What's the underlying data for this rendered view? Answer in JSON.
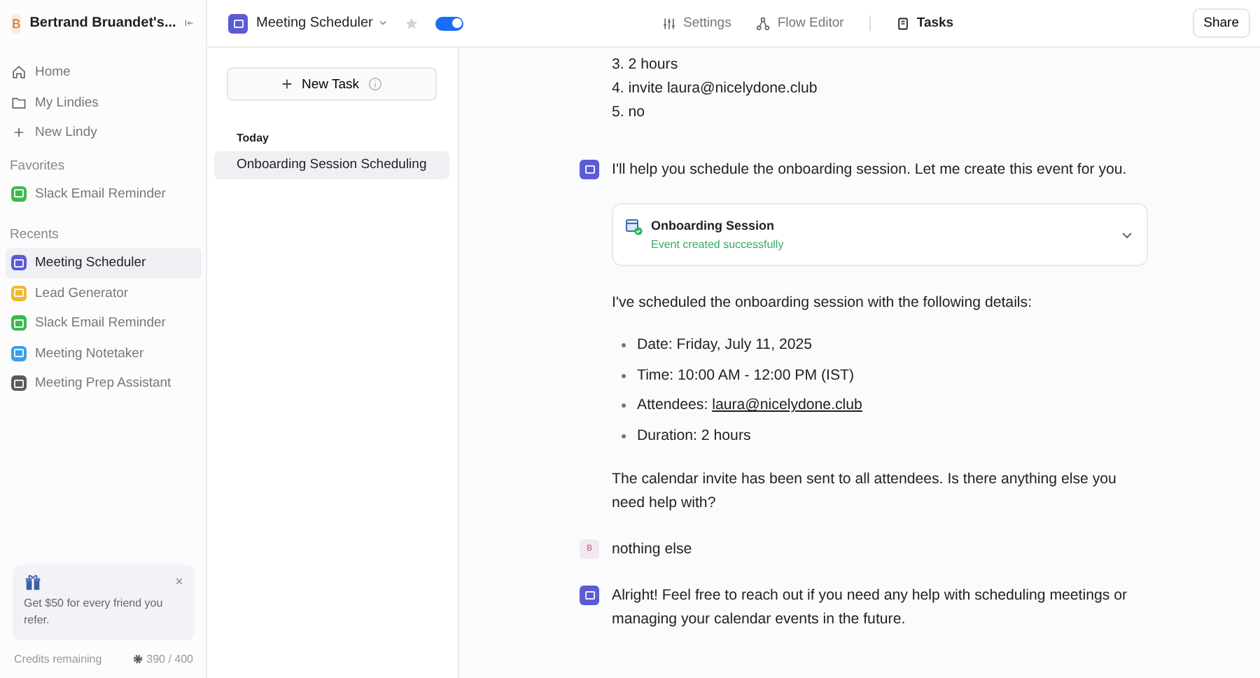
{
  "workspace": {
    "initial": "B",
    "name": "Bertrand Bruandet's..."
  },
  "nav": [
    {
      "kind": "home",
      "label": "Home"
    },
    {
      "kind": "folder",
      "label": "My Lindies"
    },
    {
      "kind": "plus",
      "label": "New Lindy"
    }
  ],
  "favorites": {
    "title": "Favorites",
    "items": [
      {
        "label": "Slack Email Reminder",
        "color": "#3cb94f",
        "selected": false
      }
    ]
  },
  "recents": {
    "title": "Recents",
    "items": [
      {
        "label": "Meeting Scheduler",
        "color": "#5b5bd6",
        "selected": true
      },
      {
        "label": "Lead Generator",
        "color": "#f2b632",
        "selected": false
      },
      {
        "label": "Slack Email Reminder",
        "color": "#3cb94f",
        "selected": false
      },
      {
        "label": "Meeting Notetaker",
        "color": "#3b9fe8",
        "selected": false
      },
      {
        "label": "Meeting Prep Assistant",
        "color": "#5a5a5a",
        "selected": false
      }
    ]
  },
  "promo": {
    "text": "Get $50 for every friend you refer."
  },
  "credits": {
    "label": "Credits remaining",
    "value": "390 / 400"
  },
  "agent": {
    "name": "Meeting Scheduler",
    "favorite": false,
    "on": true
  },
  "tabs": [
    {
      "kind": "settings",
      "label": "Settings",
      "selected": false
    },
    {
      "kind": "flow",
      "label": "Flow Editor",
      "selected": false
    },
    {
      "kind": "tasks",
      "label": "Tasks",
      "selected": true
    }
  ],
  "share_button": "Share",
  "new_task_button": "New Task",
  "task_groups": [
    {
      "title": "Today",
      "tasks": [
        {
          "label": "Onboarding Session Scheduling",
          "selected": true
        }
      ]
    }
  ],
  "messages": [
    {
      "kind": "user_continued",
      "blocks": [
        {
          "kind": "lines",
          "lines": [
            "3. 2 hours",
            "4. invite laura@nicelydone.club",
            "5. no"
          ]
        }
      ]
    },
    {
      "kind": "agent",
      "blocks": [
        {
          "kind": "paragraph",
          "text": "I'll help you schedule the onboarding session. Let me create this event for you."
        },
        {
          "kind": "event_card",
          "title": "Onboarding Session",
          "status": "Event created successfully"
        },
        {
          "kind": "paragraph",
          "text": "I've scheduled the onboarding session with the following details:"
        },
        {
          "kind": "bullets",
          "items": [
            {
              "text": "Date: Friday, July 11, 2025"
            },
            {
              "text": "Time: 10:00 AM - 12:00 PM (IST)"
            },
            {
              "text": "Attendees:",
              "link": "laura@nicelydone.club"
            },
            {
              "text": "Duration: 2 hours"
            }
          ]
        },
        {
          "kind": "paragraph",
          "text": "The calendar invite has been sent to all attendees. Is there anything else you need help with?"
        }
      ]
    },
    {
      "kind": "user",
      "avatar": "B",
      "blocks": [
        {
          "kind": "paragraph",
          "text": "nothing else"
        }
      ]
    },
    {
      "kind": "agent",
      "blocks": [
        {
          "kind": "paragraph",
          "text": "Alright! Feel free to reach out if you need any help with scheduling meetings or managing your calendar events in the future."
        }
      ]
    }
  ]
}
